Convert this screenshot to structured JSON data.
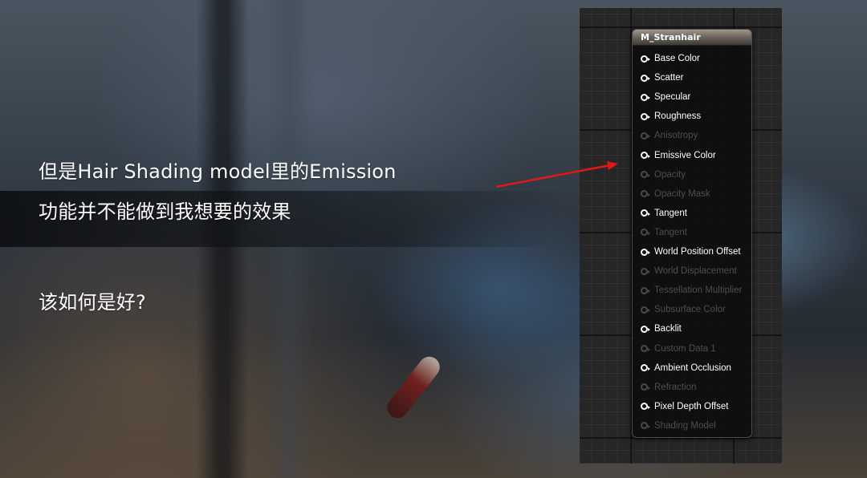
{
  "slide": {
    "line1": "但是Hair Shading model里的Emission",
    "line2": "功能并不能做到我想要的效果",
    "line3": "该如何是好?"
  },
  "node": {
    "title": "M_Stranhair",
    "pins": [
      {
        "label": "Base Color",
        "enabled": true
      },
      {
        "label": "Scatter",
        "enabled": true
      },
      {
        "label": "Specular",
        "enabled": true
      },
      {
        "label": "Roughness",
        "enabled": true
      },
      {
        "label": "Anisotropy",
        "enabled": false
      },
      {
        "label": "Emissive Color",
        "enabled": true
      },
      {
        "label": "Opacity",
        "enabled": false
      },
      {
        "label": "Opacity Mask",
        "enabled": false
      },
      {
        "label": "Tangent",
        "enabled": true
      },
      {
        "label": "Tangent",
        "enabled": false
      },
      {
        "label": "World Position Offset",
        "enabled": true
      },
      {
        "label": "World Displacement",
        "enabled": false
      },
      {
        "label": "Tessellation Multiplier",
        "enabled": false
      },
      {
        "label": "Subsurface Color",
        "enabled": false
      },
      {
        "label": "Backlit",
        "enabled": true
      },
      {
        "label": "Custom Data 1",
        "enabled": false
      },
      {
        "label": "Ambient Occlusion",
        "enabled": true
      },
      {
        "label": "Refraction",
        "enabled": false
      },
      {
        "label": "Pixel Depth Offset",
        "enabled": true
      },
      {
        "label": "Shading Model",
        "enabled": false
      }
    ]
  },
  "colors": {
    "pin_enabled": "#ffffff",
    "pin_disabled": "#4e4e4e",
    "arrow": "#e01818"
  }
}
